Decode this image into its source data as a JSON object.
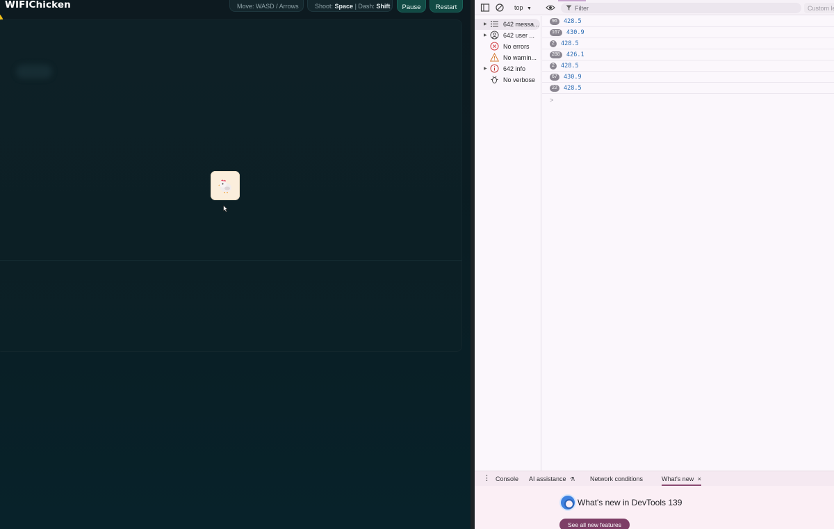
{
  "game": {
    "title": "WIFIChicken",
    "hint_move": "Move: WASD / Arrows",
    "hint_shoot_prefix": "Shoot: ",
    "hint_shoot_key": "Space",
    "hint_dash_prefix": " | Dash: ",
    "hint_dash_key": "Shift",
    "pause_label": "Pause",
    "restart_label": "Restart",
    "player_icon": "chicken-icon",
    "colors": {
      "accent_button": "#124a44",
      "orb": "#f2bf1a",
      "tile": "#fbeedc"
    }
  },
  "devtools": {
    "toolbar": {
      "context": "top",
      "filter_placeholder": "Filter",
      "custom_levels": "Custom le"
    },
    "sidebar": [
      {
        "label": "642 messa...",
        "icon": "list-icon",
        "expandable": true,
        "selected": true
      },
      {
        "label": "642 user ...",
        "icon": "user-icon",
        "expandable": true,
        "selected": false
      },
      {
        "label": "No errors",
        "icon": "error-icon",
        "expandable": false,
        "selected": false
      },
      {
        "label": "No warnin...",
        "icon": "warning-icon",
        "expandable": false,
        "selected": false
      },
      {
        "label": "642 info",
        "icon": "info-icon",
        "expandable": true,
        "selected": false
      },
      {
        "label": "No verbose",
        "icon": "bug-icon",
        "expandable": false,
        "selected": false
      }
    ],
    "log": [
      {
        "count": "96",
        "value": "428.5"
      },
      {
        "count": "167",
        "value": "430.9"
      },
      {
        "count": "2",
        "value": "428.5"
      },
      {
        "count": "288",
        "value": "426.1"
      },
      {
        "count": "2",
        "value": "428.5"
      },
      {
        "count": "67",
        "value": "430.9"
      },
      {
        "count": "22",
        "value": "428.5"
      }
    ],
    "prompt": ">",
    "drawer_tabs": [
      "Console",
      "AI assistance",
      "Network conditions",
      "What's new"
    ],
    "drawer_close": "×",
    "whats_new_title": "What's new in DevTools 139",
    "see_all_label": "See all new features",
    "colors": {
      "link_value": "#2a6bb3",
      "drawer_accent": "#8b4b72"
    }
  }
}
